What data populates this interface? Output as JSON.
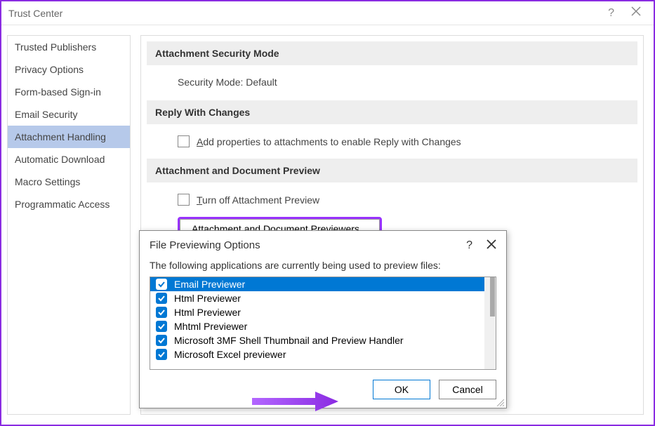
{
  "window": {
    "title": "Trust Center"
  },
  "sidebar": {
    "items": [
      {
        "label": "Trusted Publishers"
      },
      {
        "label": "Privacy Options"
      },
      {
        "label": "Form-based Sign-in"
      },
      {
        "label": "Email Security"
      },
      {
        "label": "Attachment Handling"
      },
      {
        "label": "Automatic Download"
      },
      {
        "label": "Macro Settings"
      },
      {
        "label": "Programmatic Access"
      }
    ],
    "selectedIndex": 4
  },
  "content": {
    "section1": {
      "header": "Attachment Security Mode",
      "body": "Security Mode: Default"
    },
    "section2": {
      "header": "Reply With Changes",
      "checkbox_prefix": "A",
      "checkbox_rest": "dd properties to attachments to enable Reply with Changes"
    },
    "section3": {
      "header": "Attachment and Document Preview",
      "checkbox_prefix": "T",
      "checkbox_rest": "urn off Attachment Preview",
      "button_prefix": "Attachment and Document ",
      "button_underline": "P",
      "button_rest": "reviewers..."
    }
  },
  "modal": {
    "title": "File Previewing Options",
    "desc": "The following applications are currently being used to preview files:",
    "items": [
      {
        "label": "Email Previewer",
        "selected": true
      },
      {
        "label": "Html Previewer",
        "selected": false
      },
      {
        "label": "Html Previewer",
        "selected": false
      },
      {
        "label": "Mhtml Previewer",
        "selected": false
      },
      {
        "label": "Microsoft 3MF Shell Thumbnail and Preview Handler",
        "selected": false
      },
      {
        "label": "Microsoft Excel previewer",
        "selected": false
      }
    ],
    "ok": "OK",
    "cancel": "Cancel"
  }
}
